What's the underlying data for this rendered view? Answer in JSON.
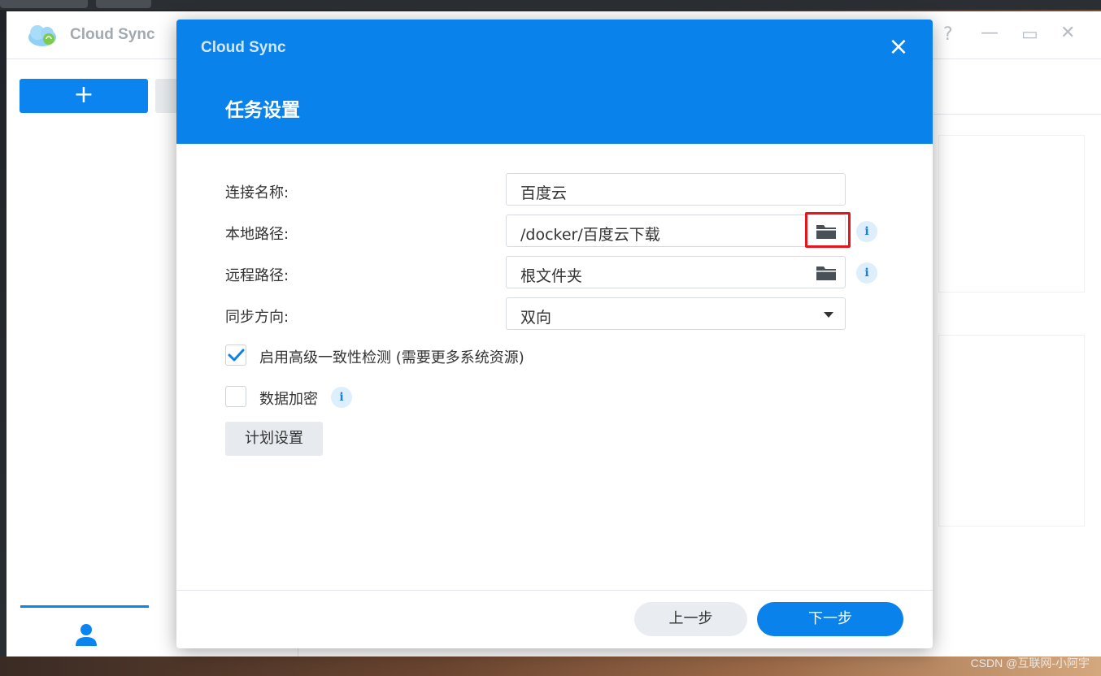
{
  "app": {
    "title": "Cloud Sync",
    "add_label": "+"
  },
  "dialog": {
    "app_title": "Cloud Sync",
    "close_label": "×",
    "title": "任务设置",
    "fields": {
      "connection_name": {
        "label": "连接名称:",
        "value": "百度云"
      },
      "local_path": {
        "label": "本地路径:",
        "value": "/docker/百度云下载"
      },
      "remote_path": {
        "label": "远程路径:",
        "value": "根文件夹"
      },
      "sync_direction": {
        "label": "同步方向:",
        "value": "双向"
      }
    },
    "advanced_check": {
      "label": "启用高级一致性检测 (需要更多系统资源)",
      "checked": true
    },
    "encryption": {
      "label": "数据加密",
      "checked": false
    },
    "info_glyph": "i",
    "plan_button": "计划设置",
    "prev_button": "上一步",
    "next_button": "下一步"
  },
  "watermark": "CSDN @互联网-小阿宇",
  "colors": {
    "accent": "#0a82ec",
    "highlight": "#e5151b"
  }
}
